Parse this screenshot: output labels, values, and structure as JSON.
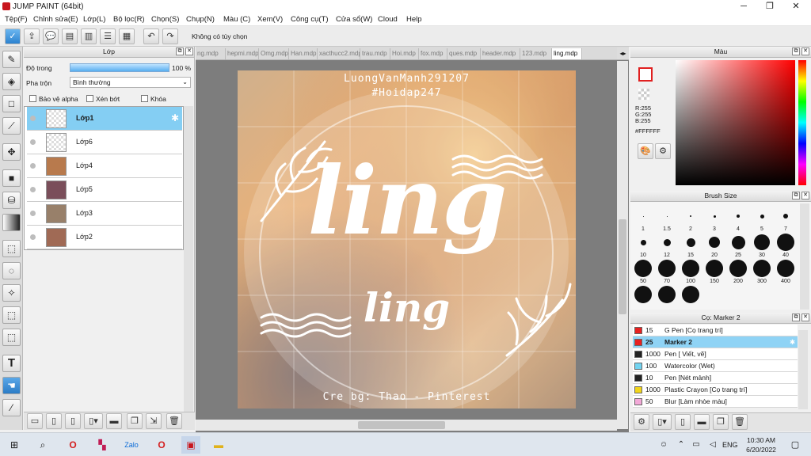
{
  "window": {
    "title": "JUMP PAINT (64bit)"
  },
  "menu": [
    "Tệp(F)",
    "Chỉnh sửa(E)",
    "Lớp(L)",
    "Bộ lọc(R)",
    "Chọn(S)",
    "Chụp(N)",
    "Màu (C)",
    "Xem(V)",
    "Công cụ(T)",
    "Cửa sổ(W)",
    "Cloud",
    "Help"
  ],
  "toolbar": {
    "selection_message": "Không có tùy chọn"
  },
  "layer_panel": {
    "title": "Lớp",
    "opacity_label": "Độ trong",
    "opacity_value": "100 %",
    "blend_label": "Pha trộn",
    "blend_value": "Bình thường",
    "options": [
      "Bảo vệ alpha",
      "Xén bớt",
      "Khóa"
    ],
    "layers": [
      {
        "name": "Lớp1",
        "selected": true,
        "thumb": "transparent"
      },
      {
        "name": "Lớp6",
        "selected": false,
        "thumb": "transparent"
      },
      {
        "name": "Lớp4",
        "selected": false,
        "thumb": "#b87a4d"
      },
      {
        "name": "Lớp5",
        "selected": false,
        "thumb": "#7a4e5a"
      },
      {
        "name": "Lớp3",
        "selected": false,
        "thumb": "#98806a"
      },
      {
        "name": "Lớp2",
        "selected": false,
        "thumb": "#a06a55"
      }
    ]
  },
  "tabs": [
    "ng.mdp",
    "hepmi.mdp",
    "Omg.mdp",
    "Han.mdp",
    "xacthucc2.mdp",
    "trau.mdp",
    "Hoi.mdp",
    "fox.mdp",
    "ques.mdp",
    "header.mdp",
    "123.mdp",
    "ling.mdp"
  ],
  "active_tab": "ling.mdp",
  "artwork": {
    "credit_name": "LuongVanManh291207",
    "hashtag": "#Hoidap247",
    "main_word": "ling",
    "sub_word": "ling",
    "credit_bottom": "Cre bg: Thao - Pinterest"
  },
  "color_panel": {
    "title": "Màu",
    "r": "R:255",
    "g": "G:255",
    "b": "B:255",
    "hex": "#FFFFFF",
    "primary": "#ffffff"
  },
  "brush_panel": {
    "title": "Brush Size",
    "sizes": [
      "1",
      "1.5",
      "2",
      "3",
      "4",
      "5",
      "7",
      "10",
      "12",
      "15",
      "20",
      "25",
      "30",
      "40",
      "50",
      "70",
      "100",
      "150",
      "200",
      "300",
      "400",
      "",
      "",
      ""
    ]
  },
  "tool_panel": {
    "title": "Cọ: Marker 2",
    "tools": [
      {
        "size": "15",
        "name": "G Pen [Cọ trang trí]",
        "color": "#e82020",
        "selected": false
      },
      {
        "size": "25",
        "name": "Marker 2",
        "color": "#e82020",
        "selected": true
      },
      {
        "size": "1000",
        "name": "Pen [ Viết, vẽ]",
        "color": "#222222",
        "selected": false
      },
      {
        "size": "100",
        "name": "Watercolor (Wet)",
        "color": "#72d3f0",
        "selected": false
      },
      {
        "size": "10",
        "name": "Pen [Nét mảnh]",
        "color": "#222222",
        "selected": false
      },
      {
        "size": "1000",
        "name": "Plastic Crayon [Cọ trang trí]",
        "color": "#f2d51a",
        "selected": false
      },
      {
        "size": "50",
        "name": "Blur [Làm nhòe màu]",
        "color": "#f3a9d8",
        "selected": false
      }
    ]
  },
  "taskbar": {
    "time": "10:30 AM",
    "date": "6/20/2022",
    "lang": "ENG"
  }
}
